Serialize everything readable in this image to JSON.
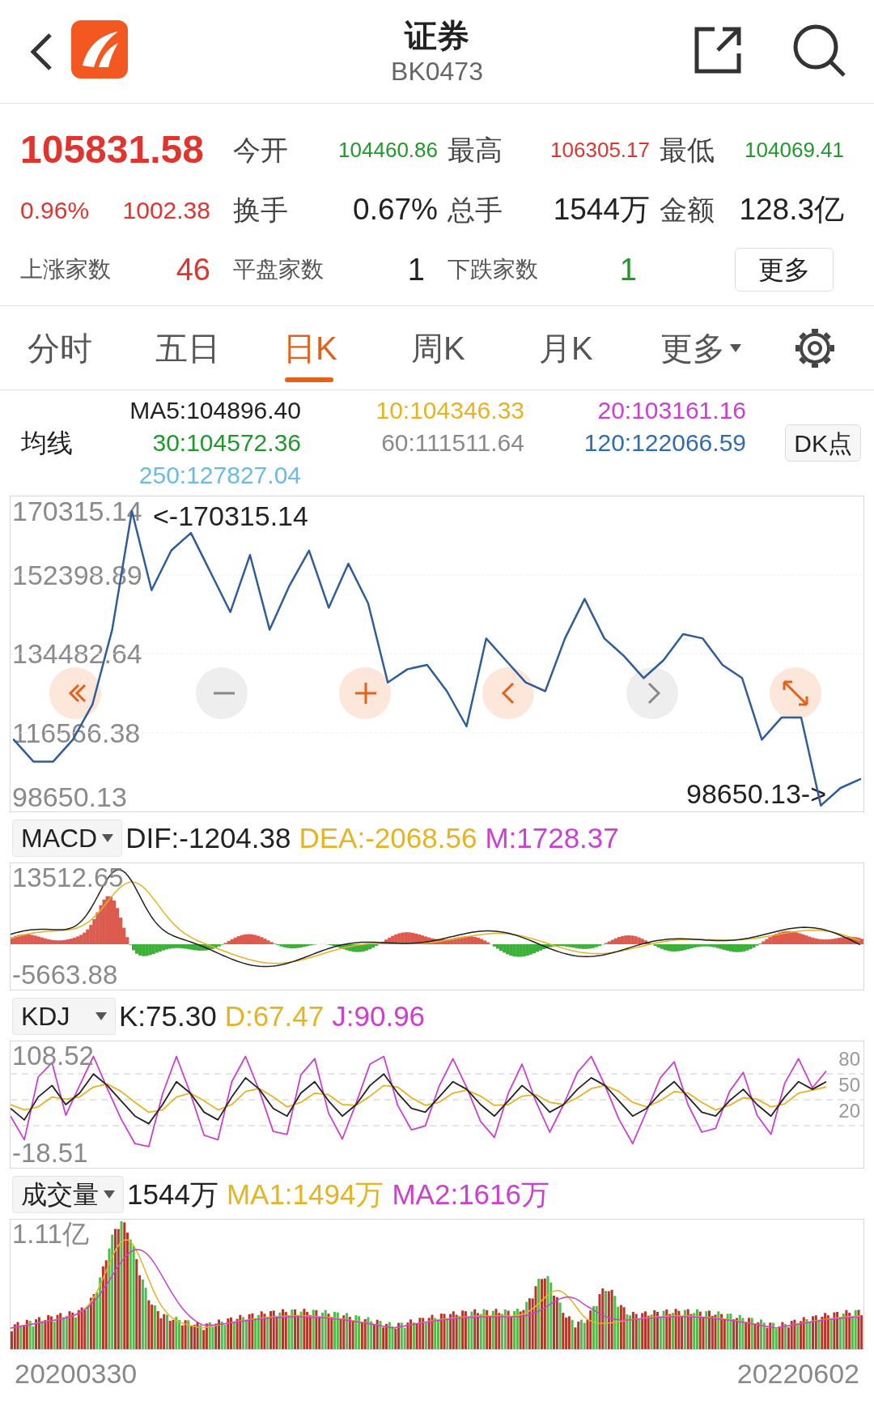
{
  "header": {
    "title": "证券",
    "code": "BK0473"
  },
  "quote": {
    "price": "105831.58",
    "change_pct": "0.96%",
    "change": "1002.38",
    "color": "#e0342f",
    "stats": [
      {
        "label": "今开",
        "value": "104460.86",
        "color": "#1f9a2a"
      },
      {
        "label": "最高",
        "value": "106305.17",
        "color": "#e0342f"
      },
      {
        "label": "最低",
        "value": "104069.41",
        "color": "#1f9a2a"
      },
      {
        "label": "换手",
        "value": "0.67%",
        "color": "#222222"
      },
      {
        "label": "总手",
        "value": "1544万",
        "color": "#222222"
      },
      {
        "label": "金额",
        "value": "128.3亿",
        "color": "#222222"
      }
    ],
    "breadth": [
      {
        "label": "上涨家数",
        "value": "46",
        "color": "#e0342f"
      },
      {
        "label": "平盘家数",
        "value": "1",
        "color": "#222222"
      },
      {
        "label": "下跌家数",
        "value": "1",
        "color": "#1f9a2a"
      }
    ],
    "more_button": "更多"
  },
  "tabs": [
    {
      "label": "分时",
      "selected": false,
      "kind": "plain"
    },
    {
      "label": "五日",
      "selected": false,
      "kind": "plain"
    },
    {
      "label": "日K",
      "selected": true,
      "kind": "plain"
    },
    {
      "label": "周K",
      "selected": false,
      "kind": "plain"
    },
    {
      "label": "月K",
      "selected": false,
      "kind": "plain"
    },
    {
      "label": "更多",
      "selected": false,
      "kind": "dropdown"
    }
  ],
  "moving_averages": {
    "label": "均线",
    "button": "DK点",
    "items": [
      {
        "text": "MA5:104896.40",
        "color": "#222222"
      },
      {
        "text": "10:104346.33",
        "color": "#e6b422"
      },
      {
        "text": "20:103161.16",
        "color": "#cc3fd1"
      },
      {
        "text": "30:104572.36",
        "color": "#1f9a2a"
      },
      {
        "text": "60:111511.64",
        "color": "#8a8a8a"
      },
      {
        "text": "120:122066.59",
        "color": "#2f6db0"
      },
      {
        "text": "250:127827.04",
        "color": "#6bbbe3"
      }
    ]
  },
  "price_chart": {
    "high_marker": "<-170315.14",
    "low_marker": "98650.13->",
    "chart_data": {
      "type": "line",
      "grid": true,
      "ylim": [
        98650.13,
        170315.14
      ],
      "yticks": [
        {
          "value": 98650.13,
          "label": "98650.13"
        },
        {
          "value": 116566.38,
          "label": "116566.38"
        },
        {
          "value": 134482.64,
          "label": "134482.64"
        },
        {
          "value": 152398.89,
          "label": "152398.89"
        },
        {
          "value": 170315.14,
          "label": "170315.14"
        }
      ],
      "series": [
        {
          "color": "#2f5d9a",
          "values": [
            115000,
            110000,
            110000,
            115000,
            123000,
            140000,
            167000,
            149000,
            158000,
            162000,
            153000,
            144000,
            157000,
            140000,
            150000,
            158000,
            145000,
            155000,
            146000,
            128000,
            131000,
            132000,
            126000,
            118000,
            138000,
            133000,
            128000,
            126000,
            138000,
            147000,
            138000,
            134000,
            129000,
            133000,
            139000,
            138000,
            132000,
            129000,
            115000,
            120000,
            120000,
            100000,
            104000,
            106000
          ]
        }
      ]
    }
  },
  "indicators": [
    {
      "kind": "macd",
      "selector": "MACD",
      "axis_labels": [
        "13512.65",
        "-5663.88"
      ],
      "readings": [
        {
          "text": "DIF:-1204.38",
          "color": "#222222"
        },
        {
          "text": "DEA:-2068.56",
          "color": "#e6b422"
        },
        {
          "text": "M:1728.37",
          "color": "#cc3fd1"
        }
      ]
    },
    {
      "kind": "kdj",
      "selector": "KDJ",
      "right_labels": [
        "80",
        "50",
        "20"
      ],
      "chart_data": {
        "type": "line",
        "ylim": [
          -37.6,
          127.6
        ],
        "yticks": [
          {
            "value": 108.52,
            "label": "108.52"
          },
          {
            "value": -18.51,
            "label": "-18.51"
          }
        ],
        "series": [
          {
            "color": "#222222",
            "values": [
              40,
              25,
              55,
              70,
              45,
              60,
              85,
              70,
              50,
              30,
              20,
              45,
              75,
              60,
              35,
              25,
              55,
              80,
              65,
              40,
              30,
              60,
              75,
              50,
              30,
              45,
              70,
              85,
              60,
              40,
              35,
              55,
              75,
              65,
              45,
              30,
              50,
              70,
              55,
              35,
              45,
              65,
              80,
              70,
              50,
              30,
              40,
              60,
              75,
              55,
              35,
              30,
              50,
              65,
              45,
              30,
              55,
              75,
              65,
              75
            ]
          },
          {
            "color": "#e6b422",
            "values": [
              45,
              38,
              42,
              55,
              52,
              55,
              68,
              72,
              62,
              48,
              35,
              38,
              55,
              60,
              50,
              38,
              45,
              62,
              66,
              55,
              42,
              48,
              60,
              58,
              45,
              44,
              56,
              70,
              68,
              54,
              44,
              48,
              60,
              64,
              56,
              44,
              45,
              56,
              58,
              48,
              45,
              54,
              66,
              70,
              62,
              48,
              42,
              50,
              62,
              60,
              48,
              38,
              44,
              54,
              52,
              42,
              46,
              60,
              64,
              68
            ]
          },
          {
            "color": "#cc3fd1",
            "values": [
              30,
              -1,
              81,
              100,
              31,
              70,
              108,
              66,
              26,
              -6,
              -10,
              59,
              108,
              60,
              5,
              -1,
              75,
              108,
              63,
              10,
              6,
              84,
              105,
              34,
              0,
              47,
              98,
              108,
              44,
              12,
              17,
              69,
              105,
              67,
              23,
              2,
              60,
              98,
              49,
              9,
              45,
              87,
              108,
              70,
              26,
              -6,
              36,
              80,
              101,
              45,
              9,
              14,
              62,
              87,
              31,
              6,
              73,
              105,
              67,
              89
            ]
          }
        ]
      },
      "readings": [
        {
          "text": "K:75.30",
          "color": "#222222"
        },
        {
          "text": "D:67.47",
          "color": "#e6b422"
        },
        {
          "text": "J:90.96",
          "color": "#cc3fd1"
        }
      ]
    },
    {
      "kind": "volume",
      "selector": "成交量",
      "axis_labels": [
        "1.11亿"
      ],
      "readings": [
        {
          "text": "1544万",
          "color": "#222222"
        },
        {
          "text": "MA1:1494万",
          "color": "#e6b422"
        },
        {
          "text": "MA2:1616万",
          "color": "#cc3fd1"
        }
      ]
    }
  ],
  "date_range": {
    "start": "20200330",
    "end": "20220602"
  }
}
